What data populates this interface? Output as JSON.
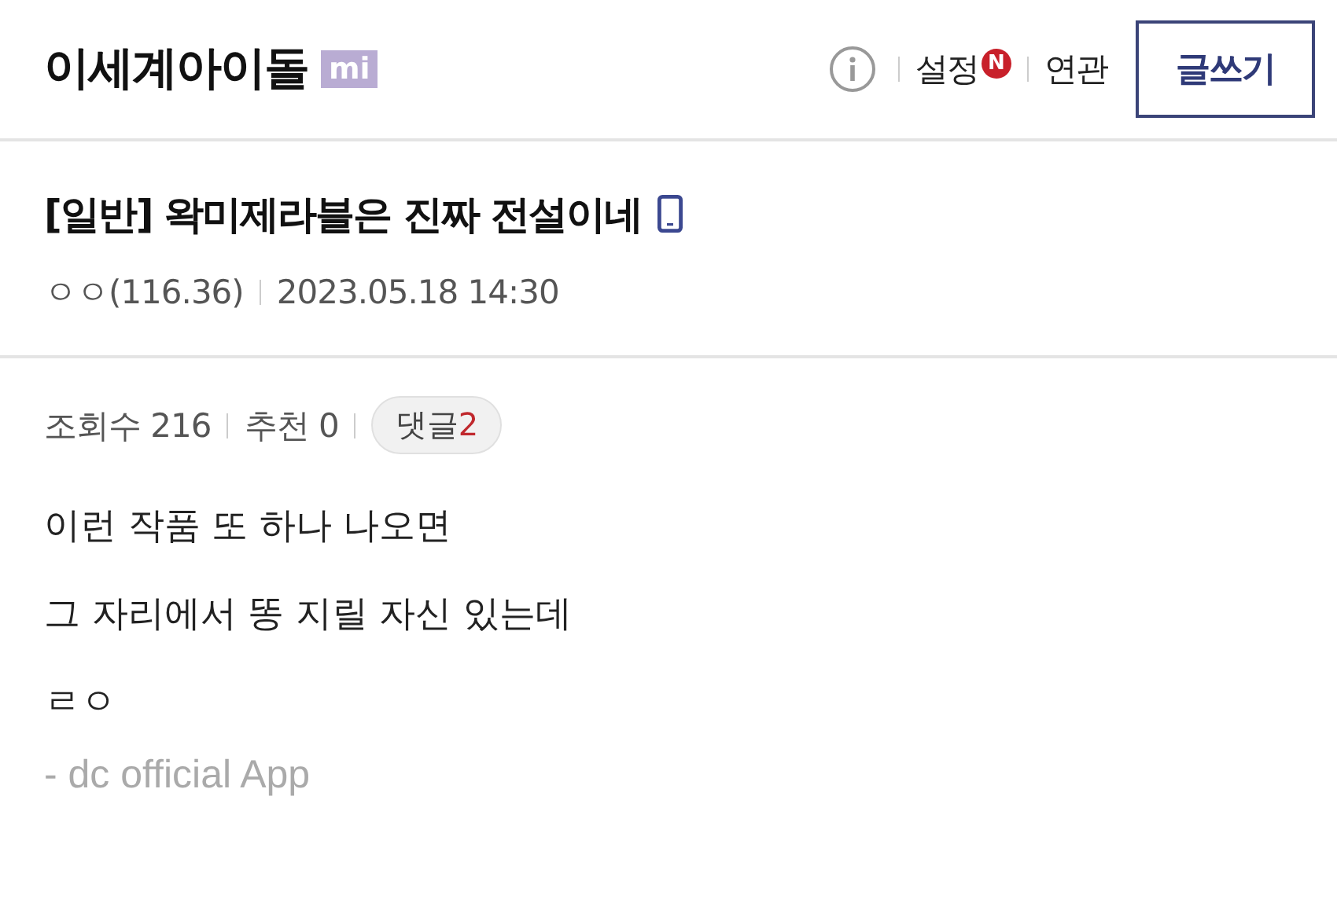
{
  "header": {
    "gallery_name": "이세계아이돌",
    "gallery_badge": "mi",
    "links": [
      {
        "label": "설정",
        "new_badge": "N"
      },
      {
        "label": "연관"
      }
    ],
    "write_button": "글쓰기"
  },
  "post": {
    "title": "[일반] 왁미제라블은 진짜 전설이네",
    "from_mobile": true,
    "author": "ㅇㅇ(116.36)",
    "date": "2023.05.18 14:30",
    "views": "조회수 216",
    "recommend": "추천 0",
    "comments_label": "댓글",
    "comments_count": "2",
    "body": [
      "이런 작품 또 하나 나오면",
      "그 자리에서 똥 지릴 자신 있는데",
      "ㄹㅇ"
    ],
    "signature": "- dc official App"
  }
}
